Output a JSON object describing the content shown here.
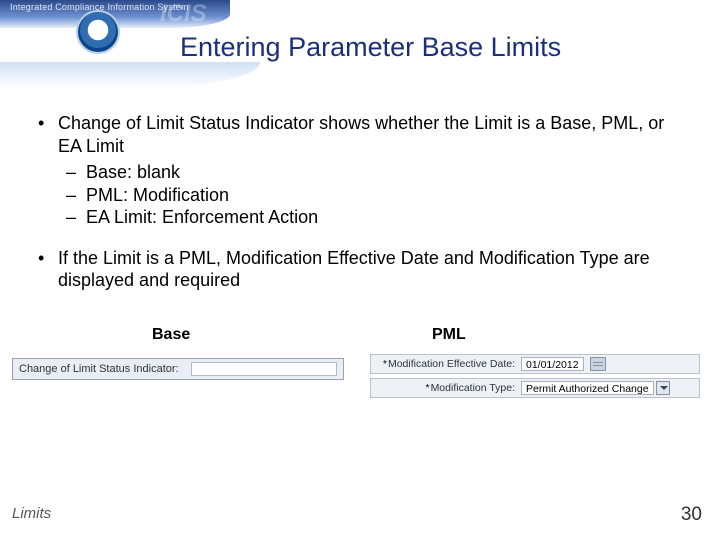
{
  "header": {
    "tagline": "Integrated Compliance Information System",
    "ghost": "ICIS"
  },
  "title": "Entering Parameter Base Limits",
  "bullets": [
    {
      "text": "Change of Limit Status Indicator shows whether the Limit is a Base, PML, or EA Limit",
      "sub": [
        "Base:  blank",
        "PML:  Modification",
        "EA Limit:  Enforcement Action"
      ]
    },
    {
      "text": "If the Limit is a PML, Modification Effective Date and Modification Type are displayed and required",
      "sub": []
    }
  ],
  "columns": {
    "base_label": "Base",
    "pml_label": "PML"
  },
  "base_panel": {
    "field_label": "Change of Limit Status Indicator:"
  },
  "pml_panel": {
    "rows": [
      {
        "label": "Modification Effective Date:",
        "value": "01/01/2012",
        "kind": "date"
      },
      {
        "label": "Modification Type:",
        "value": "Permit Authorized Change",
        "kind": "select"
      }
    ]
  },
  "footer": {
    "left": "Limits",
    "page": "30"
  }
}
